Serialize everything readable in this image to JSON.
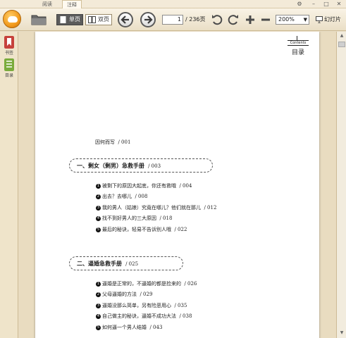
{
  "menu": {
    "tabs": [
      {
        "label": "阅读"
      },
      {
        "label": "注释"
      }
    ]
  },
  "toolbar": {
    "single_page_label": "单页",
    "double_page_label": "双页",
    "current_page": "1",
    "total_pages": "/ 236页",
    "zoom": "200%",
    "slideshow_label": "幻灯片",
    "colors": {
      "logo": "#f29a1c",
      "accent": "#5b5b5b"
    },
    "icons": [
      "logo-icon",
      "folder-icon",
      "single-page-icon",
      "double-page-icon",
      "prev-page-icon",
      "next-page-icon",
      "rotate-left-icon",
      "rotate-right-icon",
      "zoom-in-icon",
      "zoom-out-icon",
      "slideshow-icon"
    ]
  },
  "sidebar": {
    "items": [
      {
        "label": "书签",
        "icon": "bookmark-icon"
      },
      {
        "label": "目录",
        "icon": "toc-icon"
      }
    ]
  },
  "document": {
    "header_en": "Contents",
    "header_cn": "目录",
    "intro": {
      "text": "因何而写",
      "page": "/ 001"
    },
    "chapters": [
      {
        "title": "一、剩女（剩男）急救手册",
        "page": "/ 003",
        "items": [
          {
            "num": "1",
            "text": "被剩下的原因大起底，你还有救哦",
            "page": "/ 004"
          },
          {
            "num": "2",
            "text": "出去？去哪儿",
            "page": "/ 008"
          },
          {
            "num": "3",
            "text": "我的男人（姑娘）究竟在哪儿？他们就在那儿",
            "page": "/ 012"
          },
          {
            "num": "4",
            "text": "找不到好男人的三大原因",
            "page": "/ 018"
          },
          {
            "num": "5",
            "text": "最后的秘诀，轻易不告诉别人哦",
            "page": "/ 022"
          }
        ]
      },
      {
        "title": "二、逼婚急救手册",
        "page": "/ 025",
        "items": [
          {
            "num": "1",
            "text": "逼婚是正常的，不逼婚的都是捡来的",
            "page": "/ 026"
          },
          {
            "num": "2",
            "text": "父母逼婚的方法",
            "page": "/ 029"
          },
          {
            "num": "3",
            "text": "逼婚没那么简单，另有险恶用心",
            "page": "/ 035"
          },
          {
            "num": "4",
            "text": "自己做主的秘诀，逼婚不成功大法",
            "page": "/ 038"
          },
          {
            "num": "5",
            "text": "如何逼一个男人结婚",
            "page": "/ 043"
          }
        ]
      }
    ]
  }
}
